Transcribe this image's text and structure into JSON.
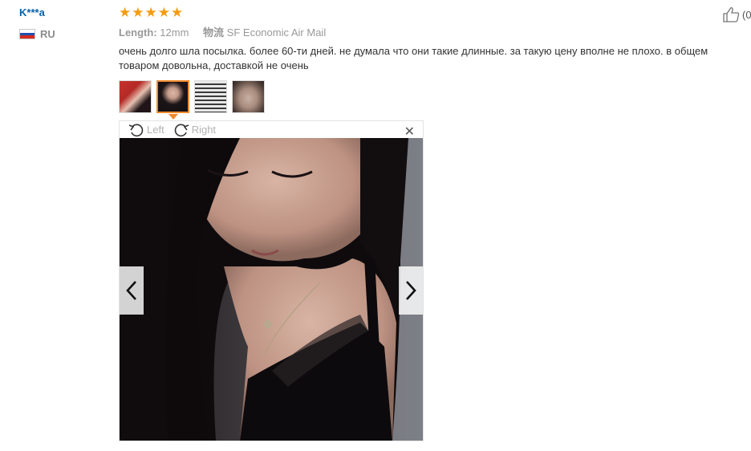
{
  "reviewer": {
    "name": "K***a",
    "country_code": "RU",
    "flag_icon": "russia-flag-icon"
  },
  "review": {
    "rating": 5,
    "rating_color": "#f39c12",
    "length_label": "Length:",
    "length_value": "12mm",
    "shipping_label": "物流",
    "shipping_value": "SF Economic Air Mail",
    "text": "очень долго шла посылка. более 60-ти дней. не думала что они такие длинные. за такую цену вполне не плохо. в общем товаром довольна, доставкой не очень",
    "helpful_count": "(0",
    "helpful_icon": "thumbs-up-icon"
  },
  "gallery": {
    "thumbnail_count": 4,
    "active_index": 1,
    "accent_color": "#f08a2c"
  },
  "viewer": {
    "rotate_left_label": "Left",
    "rotate_right_label": "Right",
    "close_symbol": "✕",
    "prev_icon": "chevron-left-icon",
    "next_icon": "chevron-right-icon"
  }
}
